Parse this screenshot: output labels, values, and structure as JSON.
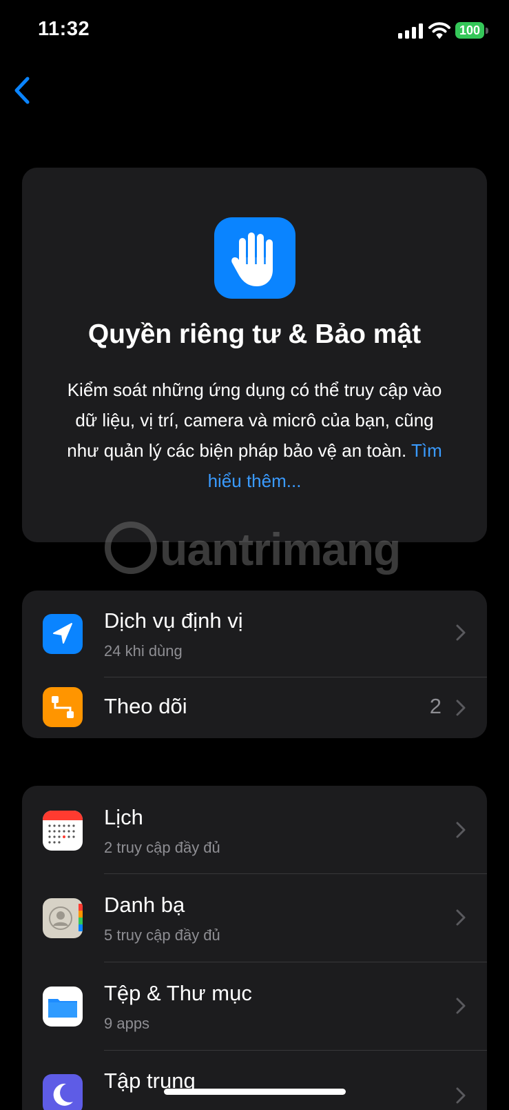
{
  "status_bar": {
    "time": "11:32",
    "battery_level": "100",
    "icons": [
      "cellular-signal-icon",
      "wifi-icon",
      "battery-icon"
    ],
    "battery_color": "#35c759"
  },
  "nav": {
    "back_icon": "chevron-left-icon",
    "accent_color": "#0a84ff"
  },
  "hero": {
    "icon": "hand-raised-icon",
    "title": "Quyền riêng tư & Bảo mật",
    "description": "Kiểm soát những ứng dụng có thể truy cập vào dữ liệu, vị trí, camera và micrô của bạn, cũng như quản lý các biện pháp bảo vệ an toàn.",
    "learn_more": "Tìm hiểu thêm..."
  },
  "watermark": {
    "text": "uantrimang"
  },
  "location_group": [
    {
      "title": "Dịch vụ định vị",
      "subtitle": "24 khi dùng",
      "icon": "location-arrow-icon",
      "color": "#0a84ff"
    },
    {
      "title": "Theo dõi",
      "count": "2",
      "icon": "tracking-icon",
      "color": "#ff9500"
    }
  ],
  "apps_group": [
    {
      "title": "Lịch",
      "subtitle": "2 truy cập đầy đủ",
      "icon": "calendar-icon"
    },
    {
      "title": "Danh bạ",
      "subtitle": "5 truy cập đầy đủ",
      "icon": "contacts-icon"
    },
    {
      "title": "Tệp & Thư mục",
      "subtitle": "9 apps",
      "icon": "files-folder-icon"
    },
    {
      "title": "Tập trung",
      "icon": "moon-icon",
      "color": "#5e5ce6"
    }
  ]
}
